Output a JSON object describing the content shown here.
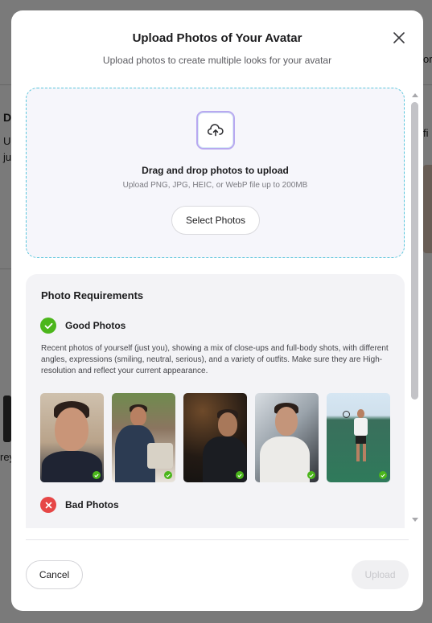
{
  "modal": {
    "title": "Upload Photos of Your Avatar",
    "subtitle": "Upload photos to create multiple looks for your avatar",
    "close_icon": "close-icon"
  },
  "dropzone": {
    "title": "Drag and drop photos to upload",
    "hint": "Upload PNG, JPG, HEIC, or WebP file up to 200MB",
    "button_label": "Select Photos",
    "icon": "cloud-upload-icon"
  },
  "requirements": {
    "title": "Photo Requirements",
    "good": {
      "label": "Good Photos",
      "description": "Recent photos of yourself (just you), showing a mix of close-ups and full-body shots, with different angles, expressions (smiling, neutral, serious), and a variety of outfits. Make sure they are High-resolution and reflect your current appearance."
    },
    "bad": {
      "label": "Bad Photos"
    }
  },
  "footer": {
    "cancel_label": "Cancel",
    "upload_label": "Upload"
  },
  "background_fragments": {
    "a": "D",
    "b": "U",
    "c": "ju",
    "d": "rey",
    "e": "or",
    "f": "fi"
  },
  "colors": {
    "accent_dashed": "#5bc6dc",
    "good": "#4cb61c",
    "bad": "#e64646",
    "upload_disabled_bg": "#f0f0f2"
  }
}
